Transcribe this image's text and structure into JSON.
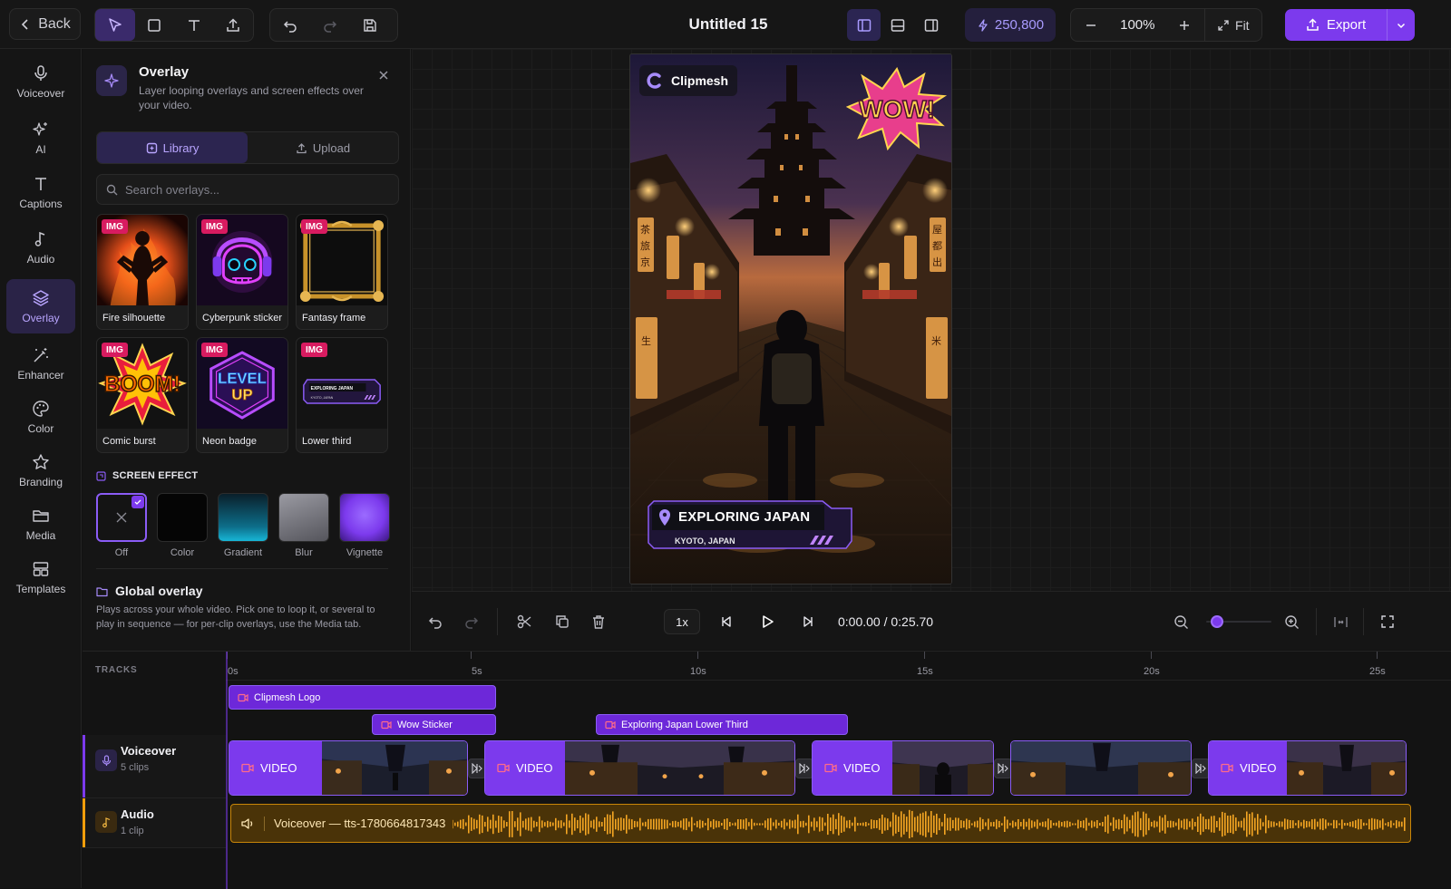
{
  "topbar": {
    "back_label": "Back",
    "title": "Untitled 15",
    "credits": "250,800",
    "zoom": "100%",
    "fit_label": "Fit",
    "export_label": "Export"
  },
  "rail": {
    "items": [
      {
        "label": "Voiceover",
        "icon": "microphone-icon"
      },
      {
        "label": "AI",
        "icon": "sparkles-icon"
      },
      {
        "label": "Captions",
        "icon": "text-icon"
      },
      {
        "label": "Audio",
        "icon": "music-note-icon"
      },
      {
        "label": "Overlay",
        "icon": "layers-icon",
        "active": true
      },
      {
        "label": "Enhancer",
        "icon": "magic-wand-icon"
      },
      {
        "label": "Color",
        "icon": "palette-icon"
      },
      {
        "label": "Branding",
        "icon": "star-icon"
      },
      {
        "label": "Media",
        "icon": "folder-icon"
      },
      {
        "label": "Templates",
        "icon": "template-icon"
      }
    ]
  },
  "panel": {
    "title": "Overlay",
    "description": "Layer looping overlays and screen effects over your video.",
    "tabs": {
      "library": "Library",
      "upload": "Upload"
    },
    "search_placeholder": "Search overlays...",
    "badge": "IMG",
    "overlays": [
      "Fire silhouette",
      "Cyberpunk sticker",
      "Fantasy frame",
      "Comic burst",
      "Neon badge",
      "Lower third"
    ],
    "comic_text": "BOOM!",
    "neon_text": {
      "line1": "LEVEL",
      "line2": "UP"
    },
    "lower_third_thumb": {
      "line1": "EXPLORING JAPAN",
      "line2": "KYOTO, JAPAN"
    },
    "screen_effect_label": "SCREEN EFFECT",
    "effects": [
      "Off",
      "Color",
      "Gradient",
      "Blur",
      "Vignette"
    ],
    "global_title": "Global overlay",
    "global_desc": "Plays across your whole video. Pick one to loop it, or several to play in sequence — for per-clip overlays, use the Media tab."
  },
  "preview": {
    "brand": "Clipmesh",
    "sticker": "WOW!",
    "lower_third": {
      "title": "EXPLORING JAPAN",
      "subtitle": "KYOTO, JAPAN"
    },
    "signs": [
      "茶",
      "旅",
      "京",
      "屋",
      "都",
      "出",
      "生",
      "米"
    ]
  },
  "transport": {
    "speed": "1x",
    "timecode": "0:00.00 / 0:25.70",
    "zoom_fraction": 0.08
  },
  "timeline": {
    "tracks_label": "TRACKS",
    "ticks": [
      "0s",
      "5s",
      "10s",
      "15s",
      "20s",
      "25s"
    ],
    "overlay_clips": [
      "Clipmesh Logo",
      "Wow Sticker",
      "Exploring Japan Lower Third"
    ],
    "voiceover_track": {
      "name": "Voiceover",
      "sub": "5 clips"
    },
    "audio_track": {
      "name": "Audio",
      "sub": "1 clip"
    },
    "video_label": "VIDEO",
    "audio_clip": "Voiceover — tts-1780664817343"
  },
  "colors": {
    "accent": "#7c3aed",
    "audio": "#f59e0b",
    "badge": "#d81b60"
  }
}
